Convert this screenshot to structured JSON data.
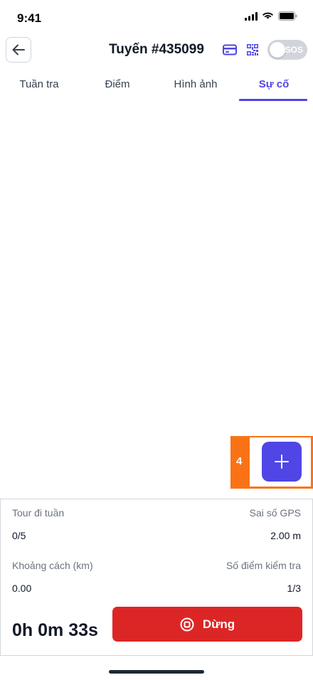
{
  "status_bar": {
    "time": "9:41"
  },
  "header": {
    "title": "Tuyến #435099",
    "sos_label": "SOS"
  },
  "tabs": [
    {
      "label": "Tuần tra"
    },
    {
      "label": "Điểm"
    },
    {
      "label": "Hình ảnh"
    },
    {
      "label": "Sự cố",
      "active": true
    }
  ],
  "fab": {
    "highlight_number": "4"
  },
  "panel": {
    "tour_label": "Tour đi tuần",
    "tour_value": "0/5",
    "gps_label": "Sai số GPS",
    "gps_value": "2.00 m",
    "distance_label": "Khoảng cách (km)",
    "distance_value": "0.00",
    "checkpoints_label": "Số điểm kiểm tra",
    "checkpoints_value": "1/3",
    "timer": "0h 0m 33s",
    "stop_label": "Dừng"
  },
  "colors": {
    "accent": "#4f46e5",
    "danger": "#dc2626",
    "highlight": "#f97316"
  }
}
